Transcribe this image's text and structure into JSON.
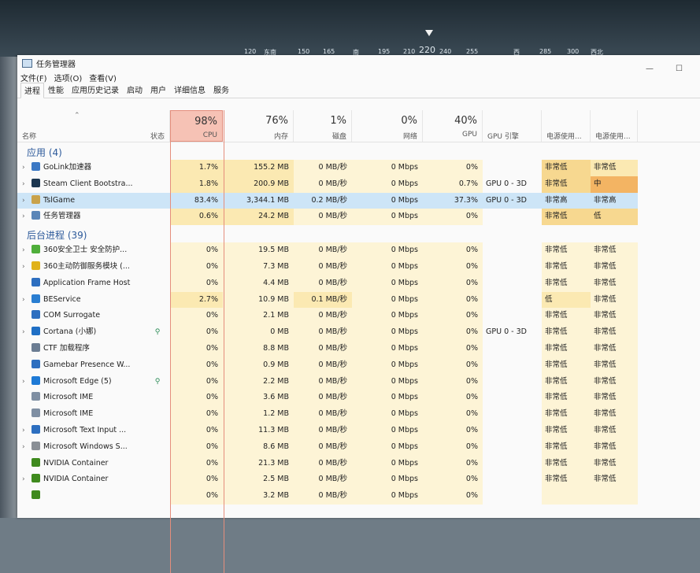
{
  "window": {
    "title": "任务管理器",
    "menu": [
      "文件(F)",
      "选项(O)",
      "查看(V)"
    ],
    "tabs": [
      "进程",
      "性能",
      "应用历史记录",
      "启动",
      "用户",
      "详细信息",
      "服务"
    ],
    "active_tab": "进程",
    "controls": {
      "minimize": "—",
      "maximize": "☐"
    }
  },
  "compass": {
    "ticks": [
      "120",
      "东南",
      "150",
      "165",
      "南",
      "195",
      "210",
      "240",
      "255",
      "西",
      "285",
      "300",
      "西北"
    ],
    "heading": "220"
  },
  "header": {
    "name": "名称",
    "status": "状态",
    "cpu": {
      "pct": "98%",
      "label": "CPU"
    },
    "memory": {
      "pct": "76%",
      "label": "内存"
    },
    "disk": {
      "pct": "1%",
      "label": "磁盘"
    },
    "network": {
      "pct": "0%",
      "label": "网络"
    },
    "gpu": {
      "pct": "40%",
      "label": "GPU"
    },
    "gpu_engine": "GPU 引擎",
    "power_usage": "电源使用...",
    "power_trend": "电源使用..."
  },
  "groups": [
    {
      "title": "应用 (4)",
      "rows": [
        {
          "name": "GoLink加速器",
          "icon": "golink-icon",
          "color": "#3b78c4",
          "expand": true,
          "cpu": "1.7%",
          "mem": "155.2 MB",
          "disk": "0 MB/秒",
          "net": "0 Mbps",
          "gpu": "0%",
          "engine": "",
          "power": "非常低",
          "trend": "非常低",
          "heat": [
            2,
            2,
            1,
            1,
            1,
            3,
            2
          ]
        },
        {
          "name": "Steam Client Bootstra...",
          "icon": "steam-icon",
          "color": "#1b3650",
          "expand": true,
          "cpu": "1.8%",
          "mem": "200.9 MB",
          "disk": "0 MB/秒",
          "net": "0 Mbps",
          "gpu": "0.7%",
          "engine": "GPU 0 - 3D",
          "power": "非常低",
          "trend": "中",
          "heat": [
            2,
            2,
            1,
            1,
            1,
            3,
            5
          ]
        },
        {
          "name": "TslGame",
          "icon": "pubg-icon",
          "color": "#c9a24a",
          "expand": true,
          "selected": true,
          "cpu": "83.4%",
          "mem": "3,344.1 MB",
          "disk": "0.2 MB/秒",
          "net": "0 Mbps",
          "gpu": "37.3%",
          "engine": "GPU 0 - 3D",
          "power": "非常高",
          "trend": "非常高",
          "heat": [
            5,
            4,
            1,
            1,
            3,
            5,
            5
          ]
        },
        {
          "name": "任务管理器",
          "icon": "task-manager-icon",
          "color": "#5a86b8",
          "expand": true,
          "cpu": "0.6%",
          "mem": "24.2 MB",
          "disk": "0 MB/秒",
          "net": "0 Mbps",
          "gpu": "0%",
          "engine": "",
          "power": "非常低",
          "trend": "低",
          "heat": [
            2,
            2,
            1,
            1,
            1,
            3,
            3
          ]
        }
      ]
    },
    {
      "title": "后台进程 (39)",
      "rows": [
        {
          "name": "360安全卫士 安全防护...",
          "icon": "360-safe-icon",
          "color": "#4fae3a",
          "expand": true,
          "cpu": "0%",
          "mem": "19.5 MB",
          "disk": "0 MB/秒",
          "net": "0 Mbps",
          "gpu": "0%",
          "engine": "",
          "power": "非常低",
          "trend": "非常低",
          "heat": [
            1,
            1,
            1,
            1,
            1,
            1,
            1
          ]
        },
        {
          "name": "360主动防御服务模块 (...",
          "icon": "360-defense-icon",
          "color": "#e0b21a",
          "expand": true,
          "cpu": "0%",
          "mem": "7.3 MB",
          "disk": "0 MB/秒",
          "net": "0 Mbps",
          "gpu": "0%",
          "engine": "",
          "power": "非常低",
          "trend": "非常低",
          "heat": [
            1,
            1,
            1,
            1,
            1,
            1,
            1
          ]
        },
        {
          "name": "Application Frame Host",
          "icon": "frame-host-icon",
          "color": "#2d6fc0",
          "expand": false,
          "cpu": "0%",
          "mem": "4.4 MB",
          "disk": "0 MB/秒",
          "net": "0 Mbps",
          "gpu": "0%",
          "engine": "",
          "power": "非常低",
          "trend": "非常低",
          "heat": [
            1,
            1,
            1,
            1,
            1,
            1,
            1
          ]
        },
        {
          "name": "BEService",
          "icon": "beservice-icon",
          "color": "#2a7ed1",
          "expand": true,
          "cpu": "2.7%",
          "mem": "10.9 MB",
          "disk": "0.1 MB/秒",
          "net": "0 Mbps",
          "gpu": "0%",
          "engine": "",
          "power": "低",
          "trend": "非常低",
          "heat": [
            2,
            1,
            2,
            1,
            1,
            2,
            1
          ]
        },
        {
          "name": "COM Surrogate",
          "icon": "com-surrogate-icon",
          "color": "#2d6fc0",
          "expand": false,
          "cpu": "0%",
          "mem": "2.1 MB",
          "disk": "0 MB/秒",
          "net": "0 Mbps",
          "gpu": "0%",
          "engine": "",
          "power": "非常低",
          "trend": "非常低",
          "heat": [
            1,
            1,
            1,
            1,
            1,
            1,
            1
          ]
        },
        {
          "name": "Cortana (小娜)",
          "icon": "cortana-icon",
          "color": "#1f6fc5",
          "expand": true,
          "leaf": true,
          "cpu": "0%",
          "mem": "0 MB",
          "disk": "0 MB/秒",
          "net": "0 Mbps",
          "gpu": "0%",
          "engine": "GPU 0 - 3D",
          "power": "非常低",
          "trend": "非常低",
          "heat": [
            1,
            1,
            1,
            1,
            1,
            1,
            1
          ]
        },
        {
          "name": "CTF 加载程序",
          "icon": "ctf-loader-icon",
          "color": "#6b7d93",
          "expand": false,
          "cpu": "0%",
          "mem": "8.8 MB",
          "disk": "0 MB/秒",
          "net": "0 Mbps",
          "gpu": "0%",
          "engine": "",
          "power": "非常低",
          "trend": "非常低",
          "heat": [
            1,
            1,
            1,
            1,
            1,
            1,
            1
          ]
        },
        {
          "name": "Gamebar Presence W...",
          "icon": "gamebar-icon",
          "color": "#2d6fc0",
          "expand": false,
          "cpu": "0%",
          "mem": "0.9 MB",
          "disk": "0 MB/秒",
          "net": "0 Mbps",
          "gpu": "0%",
          "engine": "",
          "power": "非常低",
          "trend": "非常低",
          "heat": [
            1,
            1,
            1,
            1,
            1,
            1,
            1
          ]
        },
        {
          "name": "Microsoft Edge (5)",
          "icon": "edge-icon",
          "color": "#1e7ad6",
          "expand": true,
          "leaf": true,
          "cpu": "0%",
          "mem": "2.2 MB",
          "disk": "0 MB/秒",
          "net": "0 Mbps",
          "gpu": "0%",
          "engine": "",
          "power": "非常低",
          "trend": "非常低",
          "heat": [
            1,
            1,
            1,
            1,
            1,
            1,
            1
          ]
        },
        {
          "name": "Microsoft IME",
          "icon": "ime-icon",
          "color": "#7f8fa3",
          "expand": false,
          "cpu": "0%",
          "mem": "3.6 MB",
          "disk": "0 MB/秒",
          "net": "0 Mbps",
          "gpu": "0%",
          "engine": "",
          "power": "非常低",
          "trend": "非常低",
          "heat": [
            1,
            1,
            1,
            1,
            1,
            1,
            1
          ]
        },
        {
          "name": "Microsoft IME",
          "icon": "ime-icon",
          "color": "#7f8fa3",
          "expand": false,
          "cpu": "0%",
          "mem": "1.2 MB",
          "disk": "0 MB/秒",
          "net": "0 Mbps",
          "gpu": "0%",
          "engine": "",
          "power": "非常低",
          "trend": "非常低",
          "heat": [
            1,
            1,
            1,
            1,
            1,
            1,
            1
          ]
        },
        {
          "name": "Microsoft Text Input ...",
          "icon": "text-input-icon",
          "color": "#2d6fc0",
          "expand": true,
          "cpu": "0%",
          "mem": "11.3 MB",
          "disk": "0 MB/秒",
          "net": "0 Mbps",
          "gpu": "0%",
          "engine": "",
          "power": "非常低",
          "trend": "非常低",
          "heat": [
            1,
            1,
            1,
            1,
            1,
            1,
            1
          ]
        },
        {
          "name": "Microsoft Windows S...",
          "icon": "windows-search-icon",
          "color": "#8a8f96",
          "expand": true,
          "cpu": "0%",
          "mem": "8.6 MB",
          "disk": "0 MB/秒",
          "net": "0 Mbps",
          "gpu": "0%",
          "engine": "",
          "power": "非常低",
          "trend": "非常低",
          "heat": [
            1,
            1,
            1,
            1,
            1,
            1,
            1
          ]
        },
        {
          "name": "NVIDIA Container",
          "icon": "nvidia-icon",
          "color": "#3f8a1e",
          "expand": false,
          "cpu": "0%",
          "mem": "21.3 MB",
          "disk": "0 MB/秒",
          "net": "0 Mbps",
          "gpu": "0%",
          "engine": "",
          "power": "非常低",
          "trend": "非常低",
          "heat": [
            1,
            1,
            1,
            1,
            1,
            1,
            1
          ]
        },
        {
          "name": "NVIDIA Container",
          "icon": "nvidia-icon",
          "color": "#3f8a1e",
          "expand": true,
          "cpu": "0%",
          "mem": "2.5 MB",
          "disk": "0 MB/秒",
          "net": "0 Mbps",
          "gpu": "0%",
          "engine": "",
          "power": "非常低",
          "trend": "非常低",
          "heat": [
            1,
            1,
            1,
            1,
            1,
            1,
            1
          ]
        },
        {
          "name": "",
          "icon": "process-icon",
          "color": "#3f8a1e",
          "expand": false,
          "cpu": "0%",
          "mem": "3.2 MB",
          "disk": "0 MB/秒",
          "net": "0 Mbps",
          "gpu": "0%",
          "engine": "",
          "power": "",
          "trend": "",
          "heat": [
            1,
            1,
            1,
            1,
            1,
            1,
            1
          ]
        }
      ]
    }
  ]
}
